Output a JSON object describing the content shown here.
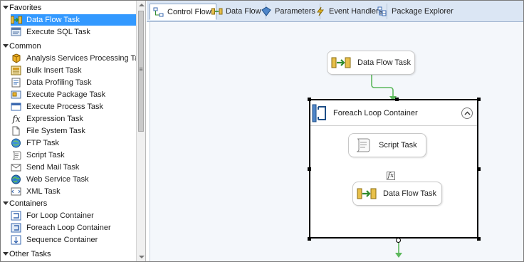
{
  "toolbox": {
    "groups": [
      {
        "label": "Favorites"
      },
      {
        "label": "Common"
      },
      {
        "label": "Containers"
      },
      {
        "label": "Other Tasks"
      }
    ],
    "favorites": [
      {
        "label": "Data Flow Task",
        "icon": "data-flow-task-icon",
        "selected": true
      },
      {
        "label": "Execute SQL Task",
        "icon": "execute-sql-task-icon"
      }
    ],
    "common": [
      {
        "label": "Analysis Services Processing Task",
        "icon": "analysis-services-icon"
      },
      {
        "label": "Bulk Insert Task",
        "icon": "bulk-insert-icon"
      },
      {
        "label": "Data Profiling Task",
        "icon": "data-profiling-icon"
      },
      {
        "label": "Execute Package Task",
        "icon": "execute-package-icon"
      },
      {
        "label": "Execute Process Task",
        "icon": "execute-process-icon"
      },
      {
        "label": "Expression Task",
        "icon": "expression-icon"
      },
      {
        "label": "File System Task",
        "icon": "file-system-icon"
      },
      {
        "label": "FTP Task",
        "icon": "ftp-icon"
      },
      {
        "label": "Script Task",
        "icon": "script-icon"
      },
      {
        "label": "Send Mail Task",
        "icon": "send-mail-icon"
      },
      {
        "label": "Web Service Task",
        "icon": "web-service-icon"
      },
      {
        "label": "XML Task",
        "icon": "xml-icon"
      }
    ],
    "containers": [
      {
        "label": "For Loop Container",
        "icon": "for-loop-icon"
      },
      {
        "label": "Foreach Loop Container",
        "icon": "foreach-loop-icon"
      },
      {
        "label": "Sequence Container",
        "icon": "sequence-icon"
      }
    ]
  },
  "tabs": [
    {
      "label": "Control Flow",
      "icon": "control-flow-icon",
      "active": true
    },
    {
      "label": "Data Flow",
      "icon": "data-flow-icon"
    },
    {
      "label": "Parameters",
      "icon": "parameters-icon"
    },
    {
      "label": "Event Handlers",
      "icon": "event-handlers-icon"
    },
    {
      "label": "Package Explorer",
      "icon": "package-explorer-icon"
    }
  ],
  "canvas": {
    "task_top": {
      "label": "Data Flow Task"
    },
    "container": {
      "label": "Foreach Loop Container"
    },
    "inner_script": {
      "label": "Script Task"
    },
    "inner_dataflow": {
      "label": "Data Flow Task"
    },
    "expression_badge": "fx"
  },
  "colors": {
    "selection": "#3399ff",
    "precedence_arrow": "#5cb85c",
    "tabbar": "#dbe6f4",
    "canvas": "#f4f7fb"
  }
}
